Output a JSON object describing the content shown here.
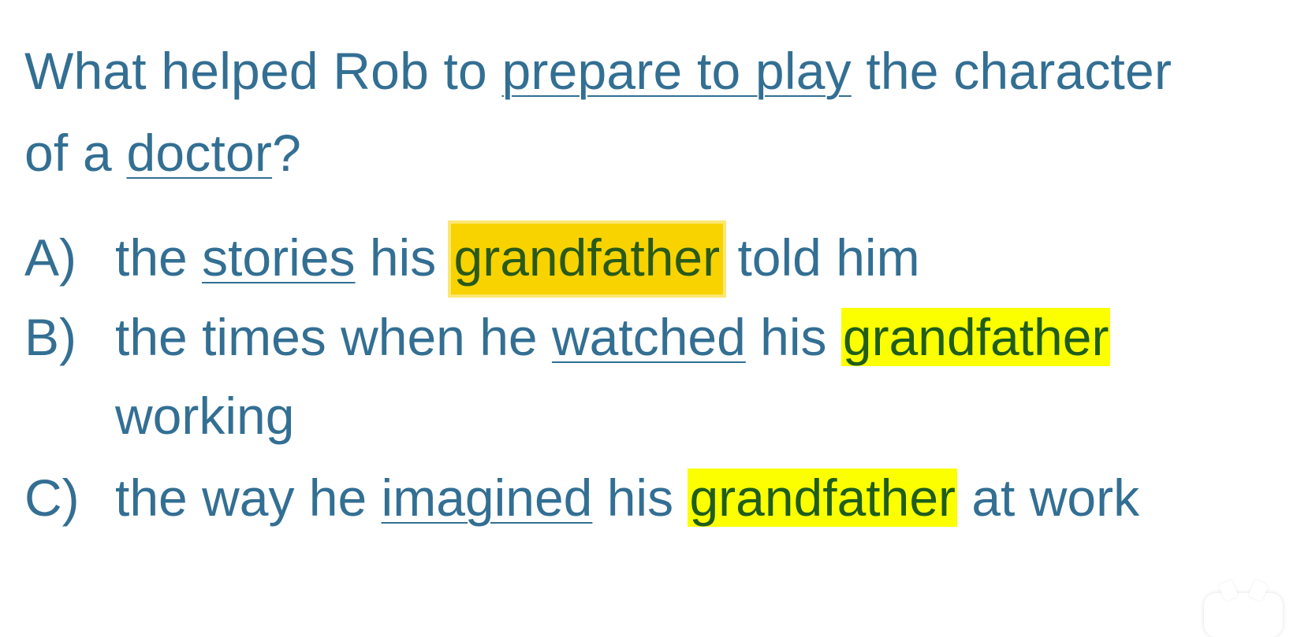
{
  "question": {
    "part1": "What helped Rob to ",
    "underline1": "prepare to play",
    "part2": " the character of a ",
    "underline2": "doctor",
    "part3": "?"
  },
  "options": [
    {
      "letter": "A)",
      "pre": "the ",
      "underline": "stories",
      "mid": " his ",
      "highlight": "grandfather",
      "post": " told him"
    },
    {
      "letter": "B)",
      "pre": "the times when he ",
      "underline": "watched",
      "mid": " his ",
      "highlight": "grandfather",
      "post": "",
      "continuation": "working"
    },
    {
      "letter": "C)",
      "pre": "the way he ",
      "underline": "imagined",
      "mid": " his ",
      "highlight": "grandfather",
      "post": " at work"
    }
  ],
  "colors": {
    "text": "#336f93",
    "highlight_yellow": "#fbff00",
    "highlight_gold": "#f8d300",
    "highlight_text": "#1f5d1c"
  }
}
